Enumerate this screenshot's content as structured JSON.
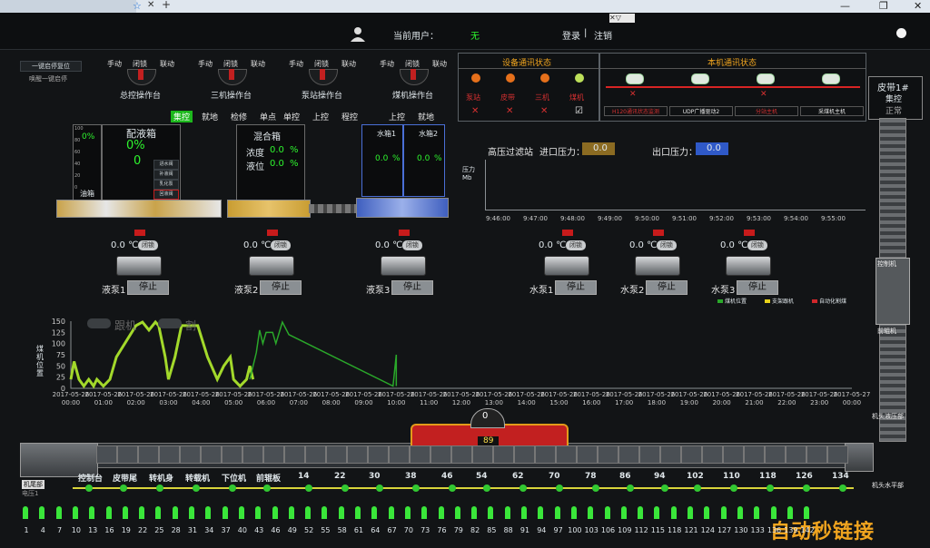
{
  "header": {
    "user_label": "当前用户：",
    "user_value": "无",
    "login": "登录",
    "divider": "|",
    "logout": "注销"
  },
  "left_btns": {
    "stop_all": "一键启停复位",
    "start_all": "唤醒一键启停"
  },
  "stations": [
    {
      "manual": "手动",
      "lock": "闭锁",
      "link": "联动",
      "name": "总控操作台"
    },
    {
      "manual": "手动",
      "lock": "闭锁",
      "link": "联动",
      "name": "三机操作台"
    },
    {
      "manual": "手动",
      "lock": "闭锁",
      "link": "联动",
      "name": "泵站操作台"
    },
    {
      "manual": "手动",
      "lock": "闭锁",
      "link": "联动",
      "name": "煤机操作台"
    }
  ],
  "dev_comm": {
    "title": "设备通讯状态",
    "items": [
      "泵站",
      "皮带",
      "三机",
      "煤机"
    ],
    "marks": [
      "✕",
      "✕",
      "✕",
      "☑"
    ]
  },
  "local_comm": {
    "title": "本机通讯状态",
    "items": [
      "H120通讯状态监测",
      "UDP广播驱动2",
      "分站主机",
      "采煤机主机"
    ],
    "marks": [
      "✕",
      "",
      "✕",
      ""
    ]
  },
  "belt_panel": {
    "title": "皮带1#",
    "sub": "集控",
    "state": "正常",
    "labels": [
      "控制机",
      "前辊机",
      "机头液压部",
      "机头水平部"
    ]
  },
  "mode_tabs": [
    "集控",
    "就地",
    "检修",
    "单点",
    "单控",
    "上控",
    "程控"
  ],
  "mode_tabs2": [
    "上控",
    "就地"
  ],
  "tank1": {
    "title": "配液箱",
    "pct": "0%",
    "val": "0",
    "gauge_pct": "0%",
    "bottom": "油箱",
    "scale": [
      "100",
      "80",
      "60",
      "40",
      "20",
      "0"
    ],
    "buttons": [
      "进水阀",
      "补液阀",
      "乳化泵",
      "回液阀"
    ]
  },
  "tank2": {
    "title": "混合箱",
    "conc_label": "浓度",
    "conc_val": "0.0",
    "conc_unit": "%",
    "level_label": "液位",
    "level_val": "0.0",
    "level_unit": "%",
    "scale": [
      "100",
      "80",
      "60",
      "40",
      "20",
      "0"
    ]
  },
  "water1": {
    "title": "水箱1",
    "val": "0.0",
    "unit": "%",
    "scale": [
      "100",
      "80",
      "60",
      "40",
      "20",
      "0"
    ]
  },
  "water2": {
    "title": "水箱2",
    "val": "0.0",
    "unit": "%",
    "scale": [
      "100",
      "80",
      "60",
      "40",
      "20",
      "0"
    ]
  },
  "pressure": {
    "filter": "高压过滤站",
    "in_label": "进口压力：",
    "in_val": "0.0",
    "out_label": "出口压力：",
    "out_val": "0.0",
    "ylabel": "压力\nMb",
    "xticks": [
      "9:46:00",
      "9:47:00",
      "9:48:00",
      "9:49:00",
      "9:50:00",
      "9:51:00",
      "9:52:00",
      "9:53:00",
      "9:54:00",
      "9:55:00"
    ]
  },
  "pumps": [
    {
      "temp": "0.0 ℃",
      "pill": "闭锁",
      "name": "液泵1",
      "btn": "停止"
    },
    {
      "temp": "0.0 ℃",
      "pill": "闭锁",
      "name": "液泵2",
      "btn": "停止"
    },
    {
      "temp": "0.0 ℃",
      "pill": "闭锁",
      "name": "液泵3",
      "btn": "停止"
    },
    {
      "temp": "0.0 ℃",
      "pill": "闭锁",
      "name": "水泵1",
      "btn": "停止"
    },
    {
      "temp": "0.0 ℃",
      "pill": "闭锁",
      "name": "水泵2",
      "btn": "停止"
    },
    {
      "temp": "0.0 ℃",
      "pill": "闭锁",
      "name": "水泵3",
      "btn": "停止"
    }
  ],
  "legend": [
    {
      "name": "煤机位置",
      "color": "#2aa82a"
    },
    {
      "name": "支架跟机",
      "color": "#e8d21a"
    },
    {
      "name": "自动化割煤",
      "color": "#d0272b"
    }
  ],
  "chart_data": {
    "type": "line",
    "ylabel": "煤\n机\n位\n置",
    "yticks": [
      "150",
      "125",
      "100",
      "75",
      "50",
      "25",
      "0"
    ],
    "ylim": [
      0,
      150
    ],
    "toggles": [
      "跟机",
      "割"
    ],
    "xtick_dates": "2017-05-26",
    "xticks": [
      "00:00",
      "01:00",
      "02:00",
      "03:00",
      "04:00",
      "05:00",
      "06:00",
      "07:00",
      "08:00",
      "09:00",
      "10:00",
      "11:00",
      "12:00",
      "13:00",
      "14:00",
      "15:00",
      "16:00",
      "17:00",
      "18:00",
      "19:00",
      "20:00",
      "21:00",
      "22:00",
      "23:00",
      "00:00"
    ],
    "xlast_date": "2017-05-27",
    "series": [
      {
        "name": "",
        "color": "#a3d92b",
        "points": [
          [
            0.0,
            20
          ],
          [
            0.1,
            60
          ],
          [
            0.25,
            20
          ],
          [
            0.4,
            5
          ],
          [
            0.55,
            20
          ],
          [
            0.7,
            5
          ],
          [
            0.8,
            20
          ],
          [
            1.0,
            5
          ],
          [
            1.2,
            20
          ],
          [
            1.4,
            70
          ],
          [
            2.0,
            140
          ],
          [
            2.2,
            148
          ],
          [
            2.4,
            130
          ],
          [
            2.6,
            148
          ],
          [
            2.7,
            140
          ],
          [
            2.9,
            70
          ],
          [
            3.0,
            20
          ],
          [
            3.2,
            70
          ],
          [
            3.4,
            140
          ],
          [
            3.9,
            140
          ],
          [
            4.2,
            70
          ],
          [
            4.5,
            20
          ],
          [
            4.7,
            50
          ],
          [
            4.9,
            70
          ],
          [
            5.0,
            20
          ],
          [
            5.2,
            5
          ],
          [
            5.4,
            20
          ],
          [
            5.5,
            50
          ],
          [
            5.6,
            20
          ]
        ]
      },
      {
        "name": "",
        "color": "#2aa82a",
        "points": [
          [
            5.5,
            20
          ],
          [
            5.7,
            80
          ],
          [
            5.8,
            130
          ],
          [
            5.9,
            100
          ],
          [
            6.0,
            125
          ],
          [
            6.2,
            125
          ],
          [
            6.3,
            100
          ],
          [
            6.5,
            148
          ],
          [
            6.7,
            120
          ],
          [
            9.9,
            5
          ],
          [
            10.0,
            75
          ],
          [
            10.0,
            5
          ]
        ]
      }
    ]
  },
  "conveyor": {
    "stops": [
      "控制台",
      "皮带尾",
      "转机身",
      "转载机",
      "下位机",
      "前辊板",
      "14",
      "22",
      "30",
      "38",
      "46",
      "54",
      "62",
      "70",
      "78",
      "86",
      "94",
      "102",
      "110",
      "118",
      "126",
      "134"
    ],
    "left_labels": [
      "机尾部",
      "电压1"
    ],
    "right_labels": [
      "机头水平部"
    ],
    "dial_val": "0",
    "center_val": "89"
  },
  "sensors": [
    "1",
    "4",
    "7",
    "10",
    "13",
    "16",
    "19",
    "22",
    "25",
    "28",
    "31",
    "34",
    "37",
    "40",
    "43",
    "46",
    "49",
    "52",
    "55",
    "58",
    "61",
    "64",
    "67",
    "70",
    "73",
    "76",
    "79",
    "82",
    "85",
    "88",
    "91",
    "94",
    "97",
    "100",
    "103",
    "106",
    "109",
    "112",
    "115",
    "118",
    "121",
    "124",
    "127",
    "130",
    "133",
    "136",
    "139",
    "142"
  ],
  "watermark": "自动秒链接"
}
